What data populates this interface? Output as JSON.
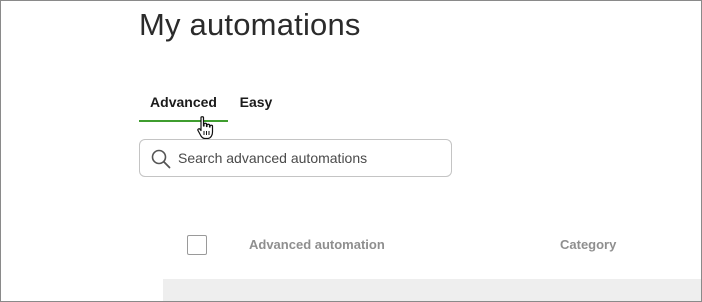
{
  "page": {
    "title": "My automations"
  },
  "tabs": [
    {
      "label": "Advanced",
      "active": true
    },
    {
      "label": "Easy",
      "active": false
    }
  ],
  "search": {
    "placeholder": "Search advanced automations",
    "value": ""
  },
  "table": {
    "columns": [
      {
        "label": "Advanced automation"
      },
      {
        "label": "Category"
      }
    ],
    "select_all_checked": false,
    "rows": []
  },
  "colors": {
    "accent": "#3f9d2f",
    "header_text": "#8f8f8f",
    "row_background": "#eeeeee"
  }
}
